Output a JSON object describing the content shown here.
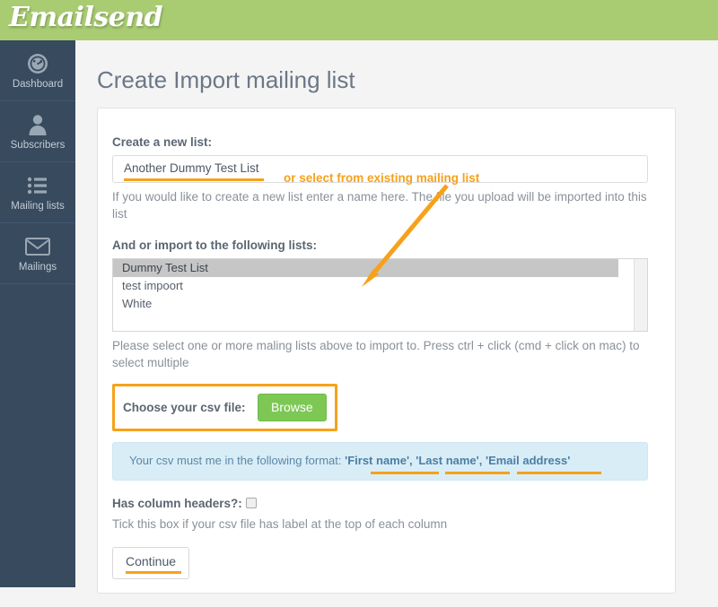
{
  "brand": {
    "logo_text": "Emailsend",
    "header_color": "#a9cc73",
    "sidebar_color": "#374a5e",
    "accent_orange": "#f7a11a",
    "green_button": "#7dc855"
  },
  "sidebar": {
    "items": [
      {
        "label": "Dashboard",
        "icon": "gauge-icon"
      },
      {
        "label": "Subscribers",
        "icon": "person-icon"
      },
      {
        "label": "Mailing lists",
        "icon": "list-icon"
      },
      {
        "label": "Mailings",
        "icon": "envelope-icon"
      }
    ]
  },
  "page": {
    "title": "Create Import mailing list"
  },
  "form": {
    "new_list_label": "Create a new list:",
    "new_list_value": "Another Dummy Test List",
    "new_list_help": "If you would like to create a new list enter a name here. The file you upload will be imported into this list",
    "existing_lists_label": "And or import to the following lists:",
    "existing_lists": [
      {
        "label": "Dummy Test List",
        "selected": true
      },
      {
        "label": "test impoort",
        "selected": false
      },
      {
        "label": "White",
        "selected": false
      }
    ],
    "lists_help": "Please select one or more maling lists above to import to. Press ctrl + click (cmd + click on mac) to select multiple",
    "file_label": "Choose your csv file:",
    "browse_label": "Browse",
    "info_prefix": "Your csv must me in the following format: ",
    "info_fields": "'First name', 'Last name', 'Email address'",
    "headers_label": "Has column headers?:",
    "headers_checked": false,
    "headers_help": "Tick this box if your csv file has label at the top of each column",
    "continue_label": "Continue"
  },
  "annotations": {
    "existing_list_note": "or select from existing mailing list"
  }
}
